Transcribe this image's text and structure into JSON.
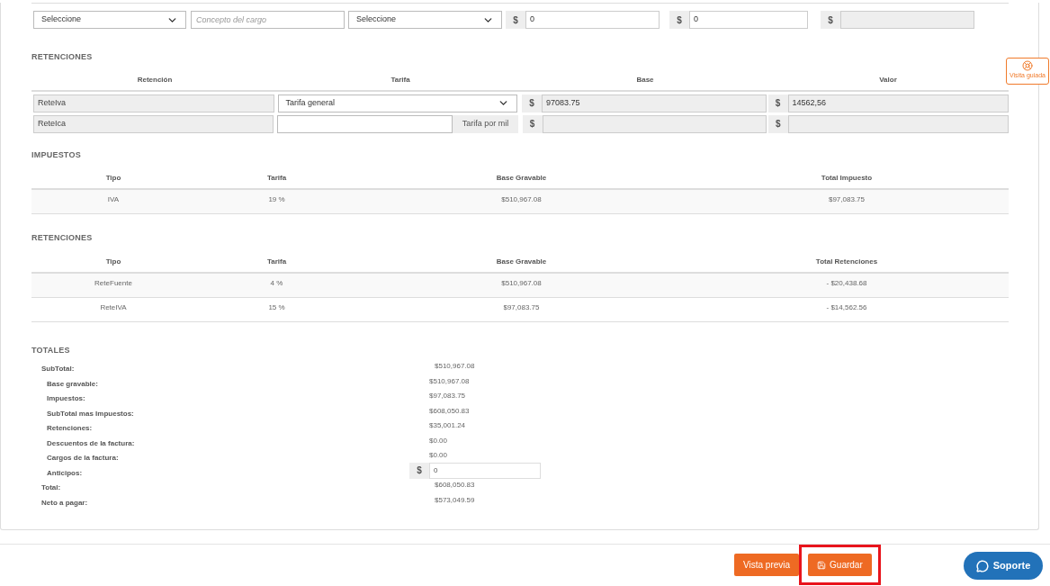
{
  "charges_row": {
    "type_select": "Seleccione",
    "concept_placeholder": "Concepto del cargo",
    "second_select": "Seleccione",
    "base": {
      "currency": "$",
      "value": "0"
    },
    "value": {
      "currency": "$",
      "value": "0"
    },
    "total": {
      "currency": "$"
    }
  },
  "withholdings_form": {
    "title": "RETENCIONES",
    "columns": [
      "Retención",
      "Tarifa",
      "Base",
      "Valor"
    ],
    "rows": [
      {
        "name": "ReteIva",
        "kind": "select",
        "tariff": "Tarifa general",
        "base_currency": "$",
        "base": "97083.75",
        "value_currency": "$",
        "value": "14562,56"
      },
      {
        "name": "ReteIca",
        "kind": "input",
        "tariff_addon": "Tarifa por mil",
        "base_currency": "$",
        "value_currency": "$"
      }
    ]
  },
  "taxes_table": {
    "title": "IMPUESTOS",
    "columns": [
      "Tipo",
      "Tarifa",
      "Base Gravable",
      "Total Impuesto"
    ],
    "rows": [
      [
        "IVA",
        "19 %",
        "$510,967.08",
        "$97,083.75"
      ]
    ]
  },
  "withholdings_table": {
    "title": "RETENCIONES",
    "columns": [
      "Tipo",
      "Tarifa",
      "Base Gravable",
      "Total Retenciones"
    ],
    "rows": [
      [
        "ReteFuente",
        "4 %",
        "$510,967.08",
        "- $20,438.68"
      ],
      [
        "ReteIVA",
        "15 %",
        "$97,083.75",
        "- $14,562.56"
      ]
    ]
  },
  "totals": {
    "title": "TOTALES",
    "rows": [
      {
        "label": "SubTotal:",
        "value": "$510,967.08",
        "children": [
          {
            "label": "Base gravable:",
            "value": "$510,967.08"
          },
          {
            "label": "Impuestos:",
            "value": "$97,083.75"
          },
          {
            "label": "SubTotal mas Impuestos:",
            "value": "$608,050.83"
          },
          {
            "label": "Retenciones:",
            "value": "$35,001.24"
          },
          {
            "label": "Descuentos de la factura:",
            "value": "$0.00"
          },
          {
            "label": "Cargos de la factura:",
            "value": "$0.00"
          },
          {
            "label": "Anticipos:",
            "kind": "input",
            "currency": "$",
            "value": "0"
          }
        ]
      },
      {
        "label": "Total:",
        "value": "$608,050.83"
      },
      {
        "label": "Neto a pagar:",
        "value": "$573,049.59"
      }
    ]
  },
  "guide_tab": {
    "label": "Visita guiada"
  },
  "footer": {
    "buttons": [
      {
        "label": "Vista previa",
        "kind": "preview",
        "highlighted": false
      },
      {
        "label": "Guardar",
        "kind": "save",
        "highlighted": true
      }
    ],
    "support": {
      "label": "Soporte"
    }
  }
}
